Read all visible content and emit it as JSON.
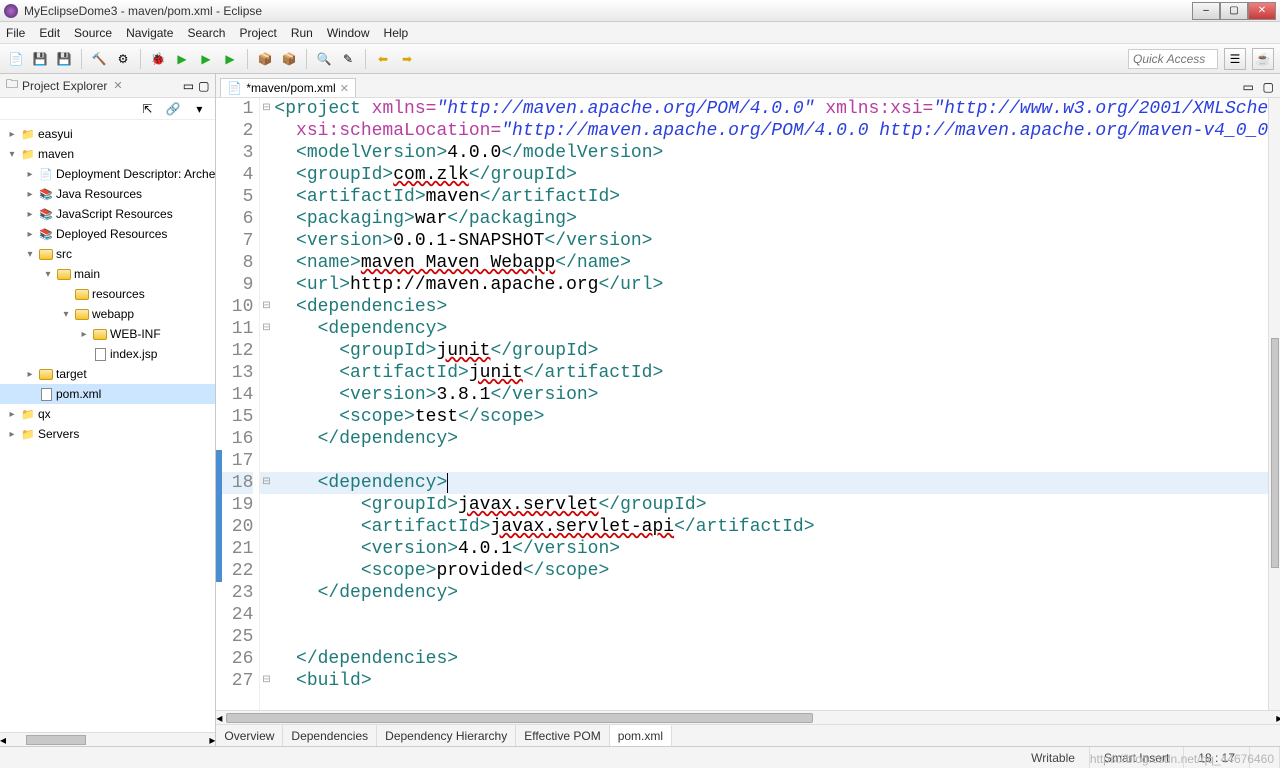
{
  "window": {
    "title": "MyEclipseDome3 - maven/pom.xml - Eclipse"
  },
  "menu": [
    "File",
    "Edit",
    "Source",
    "Navigate",
    "Search",
    "Project",
    "Run",
    "Window",
    "Help"
  ],
  "quick_access": {
    "placeholder": "Quick Access"
  },
  "project_explorer": {
    "title": "Project Explorer",
    "items": [
      {
        "depth": 0,
        "tw": "▸",
        "icon": "proj",
        "label": "easyui"
      },
      {
        "depth": 0,
        "tw": "▾",
        "icon": "proj",
        "label": "maven"
      },
      {
        "depth": 1,
        "tw": "▸",
        "icon": "desc",
        "label": "Deployment Descriptor: Arche"
      },
      {
        "depth": 1,
        "tw": "▸",
        "icon": "lib",
        "label": "Java Resources"
      },
      {
        "depth": 1,
        "tw": "▸",
        "icon": "lib",
        "label": "JavaScript Resources"
      },
      {
        "depth": 1,
        "tw": "▸",
        "icon": "lib",
        "label": "Deployed Resources"
      },
      {
        "depth": 1,
        "tw": "▾",
        "icon": "folder",
        "label": "src"
      },
      {
        "depth": 2,
        "tw": "▾",
        "icon": "folder",
        "label": "main"
      },
      {
        "depth": 3,
        "tw": "",
        "icon": "folder",
        "label": "resources"
      },
      {
        "depth": 3,
        "tw": "▾",
        "icon": "folder",
        "label": "webapp"
      },
      {
        "depth": 4,
        "tw": "▸",
        "icon": "folder",
        "label": "WEB-INF"
      },
      {
        "depth": 4,
        "tw": "",
        "icon": "file",
        "label": "index.jsp"
      },
      {
        "depth": 1,
        "tw": "▸",
        "icon": "folder",
        "label": "target"
      },
      {
        "depth": 1,
        "tw": "",
        "icon": "file",
        "label": "pom.xml",
        "selected": true
      },
      {
        "depth": 0,
        "tw": "▸",
        "icon": "proj",
        "label": "qx"
      },
      {
        "depth": 0,
        "tw": "▸",
        "icon": "proj",
        "label": "Servers"
      }
    ]
  },
  "editor": {
    "tab_label": "*maven/pom.xml",
    "bottom_tabs": [
      "Overview",
      "Dependencies",
      "Dependency Hierarchy",
      "Effective POM",
      "pom.xml"
    ],
    "active_bottom": 4,
    "lines": {
      "count": 27,
      "highlight": 18
    }
  },
  "code": {
    "l1": {
      "pre": "<project",
      "attr1": "xmlns=",
      "str1": "\"http://maven.apache.org/POM/4.0.0\"",
      "attr2": "xmlns:xsi=",
      "str2": "\"http://www.w3.org/2001/XMLSche"
    },
    "l2": {
      "attr": "xsi:schemaLocation=",
      "str": "\"http://maven.apache.org/POM/4.0.0 http://maven.apache.org/maven-v4_0_0"
    },
    "l3": {
      "a": "<modelVersion>",
      "t": "4.0.0",
      "b": "</modelVersion>"
    },
    "l4": {
      "a": "<groupId>",
      "t": "com.zlk",
      "b": "</groupId>"
    },
    "l5": {
      "a": "<artifactId>",
      "t": "maven",
      "b": "</artifactId>"
    },
    "l6": {
      "a": "<packaging>",
      "t": "war",
      "b": "</packaging>"
    },
    "l7": {
      "a": "<version>",
      "t": "0.0.1-SNAPSHOT",
      "b": "</version>"
    },
    "l8": {
      "a": "<name>",
      "t": "maven Maven Webapp",
      "b": "</name>"
    },
    "l9": {
      "a": "<url>",
      "t": "http://maven.apache.org",
      "b": "</url>"
    },
    "l10": {
      "a": "<dependencies>"
    },
    "l11": {
      "a": "<dependency>"
    },
    "l12": {
      "a": "<groupId>",
      "t": "junit",
      "b": "</groupId>"
    },
    "l13": {
      "a": "<artifactId>",
      "t": "junit",
      "b": "</artifactId>"
    },
    "l14": {
      "a": "<version>",
      "t": "3.8.1",
      "b": "</version>"
    },
    "l15": {
      "a": "<scope>",
      "t": "test",
      "b": "</scope>"
    },
    "l16": {
      "a": "</dependency>"
    },
    "l18": {
      "a": "<dependency>"
    },
    "l19": {
      "a": "<groupId>",
      "t": "javax.servlet",
      "b": "</groupId>"
    },
    "l20": {
      "a": "<artifactId>",
      "t": "javax.servlet-api",
      "b": "</artifactId>"
    },
    "l21": {
      "a": "<version>",
      "t": "4.0.1",
      "b": "</version>"
    },
    "l22": {
      "a": "<scope>",
      "t": "provided",
      "b": "</scope>"
    },
    "l23": {
      "a": "</dependency>"
    },
    "l26": {
      "a": "</dependencies>"
    },
    "l27": {
      "a": "<build>"
    }
  },
  "status": {
    "writable": "Writable",
    "insert": "Smart Insert",
    "pos": "18 : 17"
  },
  "watermark": "https://blog.csdn.net/qq_44676460"
}
